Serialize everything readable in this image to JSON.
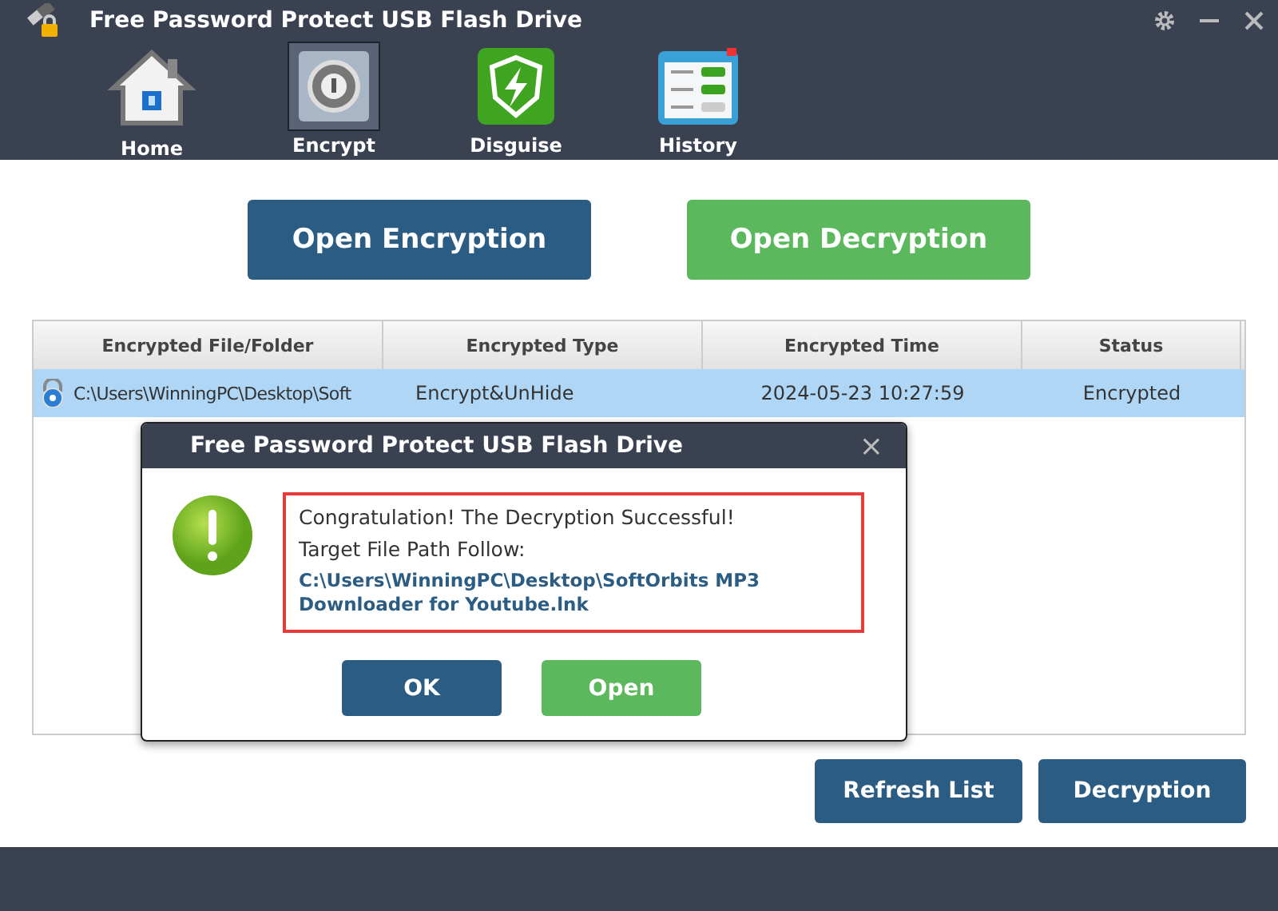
{
  "window": {
    "title": "Free Password Protect USB Flash Drive"
  },
  "tabs": [
    {
      "label": "Home",
      "kind": "home",
      "selected": false
    },
    {
      "label": "Encrypt",
      "kind": "safe",
      "selected": true
    },
    {
      "label": "Disguise",
      "kind": "shield",
      "selected": false
    },
    {
      "label": "History",
      "kind": "list",
      "selected": false
    }
  ],
  "actions": [
    {
      "label": "Open Encryption",
      "kind": "primary"
    },
    {
      "label": "Open Decryption",
      "kind": "success"
    }
  ],
  "table": {
    "columns": [
      "Encrypted File/Folder",
      "Encrypted Type",
      "Encrypted Time",
      "Status"
    ],
    "rows": [
      {
        "cells": [
          "C:\\Users\\WinningPC\\Desktop\\Soft",
          "Encrypt&UnHide",
          "2024-05-23 10:27:59",
          "Encrypted"
        ],
        "selected": true
      }
    ]
  },
  "dialog": {
    "title": "Free Password Protect USB Flash Drive",
    "close": "×",
    "message": "Congratulation! The Decryption Successful!",
    "path_label": "Target File Path Follow:",
    "path": "C:\\Users\\WinningPC\\Desktop\\SoftOrbits MP3 Downloader for Youtube.lnk",
    "buttons": [
      {
        "label": "OK",
        "kind": "primary"
      },
      {
        "label": "Open",
        "kind": "success"
      }
    ]
  },
  "footer_buttons": [
    {
      "label": "Refresh List",
      "kind": "primary"
    },
    {
      "label": "Decryption",
      "kind": "primary"
    }
  ]
}
